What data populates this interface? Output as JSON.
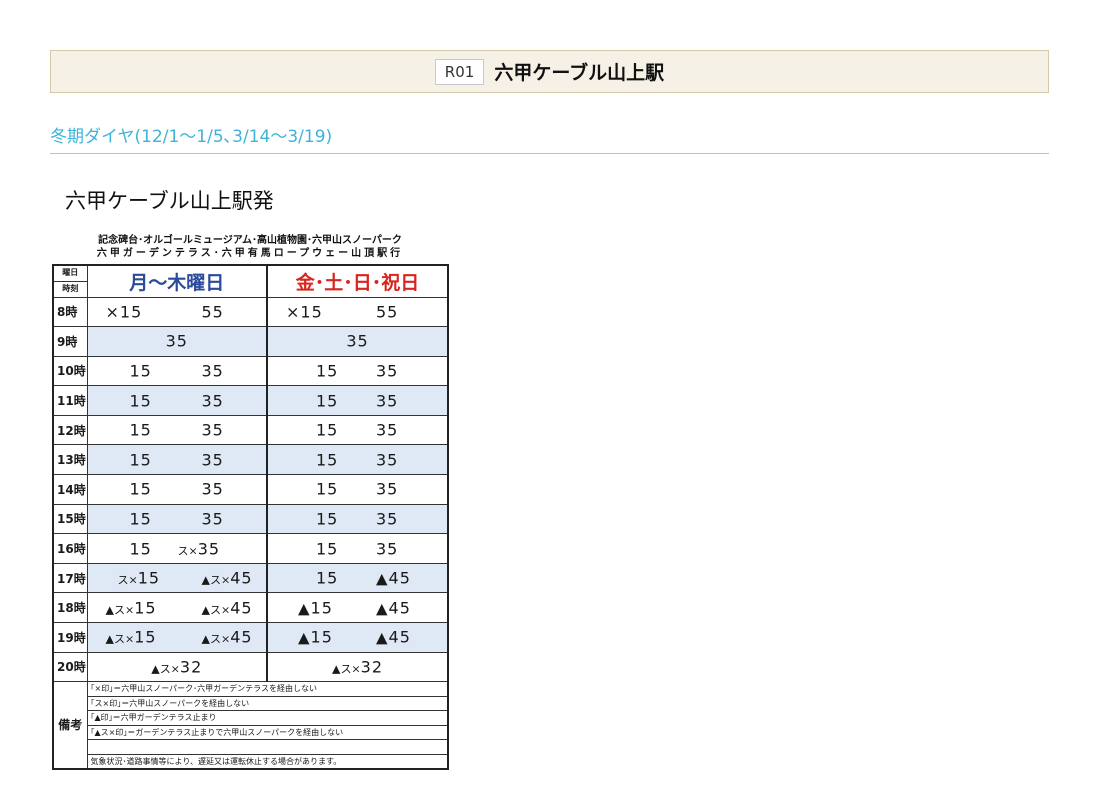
{
  "station": {
    "code": "R01",
    "name": "六甲ケーブル山上駅"
  },
  "period": "冬期ダイヤ(12/1～1/5､3/14～3/19)",
  "departure_title": "六甲ケーブル山上駅発",
  "destinations": {
    "line1": "記念碑台･オルゴールミュージアム･高山植物園･六甲山スノーパーク",
    "line2": "六甲ガーデンテラス･六甲有馬ロープウェー山頂駅行"
  },
  "header": {
    "youbi": "曜日",
    "jikoku": "時刻",
    "weekday": "月～木曜日",
    "weekend": "金･土･日･祝日"
  },
  "rows": [
    {
      "hour": "8時",
      "blue": false,
      "wk": [
        "×15",
        "55"
      ],
      "we": [
        "×15",
        "55"
      ]
    },
    {
      "hour": "9時",
      "blue": true,
      "wk_full": "35",
      "we_full": "35"
    },
    {
      "hour": "10時",
      "blue": false,
      "wk": [
        "15",
        "35"
      ],
      "we": [
        "15",
        "35"
      ]
    },
    {
      "hour": "11時",
      "blue": true,
      "wk": [
        "15",
        "35"
      ],
      "we": [
        "15",
        "35"
      ]
    },
    {
      "hour": "12時",
      "blue": false,
      "wk": [
        "15",
        "35"
      ],
      "we": [
        "15",
        "35"
      ]
    },
    {
      "hour": "13時",
      "blue": true,
      "wk": [
        "15",
        "35"
      ],
      "we": [
        "15",
        "35"
      ]
    },
    {
      "hour": "14時",
      "blue": false,
      "wk": [
        "15",
        "35"
      ],
      "we": [
        "15",
        "35"
      ]
    },
    {
      "hour": "15時",
      "blue": true,
      "wk": [
        "15",
        "35"
      ],
      "we": [
        "15",
        "35"
      ]
    },
    {
      "hour": "16時",
      "blue": false,
      "wk": [
        "15",
        "ス×35"
      ],
      "we": [
        "15",
        "35"
      ]
    },
    {
      "hour": "17時",
      "blue": true,
      "wk": [
        "ス×15",
        "▲ス×45"
      ],
      "we": [
        "15",
        "▲45"
      ]
    },
    {
      "hour": "18時",
      "blue": false,
      "wk": [
        "▲ス×15",
        "▲ス×45"
      ],
      "we": [
        "▲15",
        "▲45"
      ]
    },
    {
      "hour": "19時",
      "blue": true,
      "wk": [
        "▲ス×15",
        "▲ス×45"
      ],
      "we": [
        "▲15",
        "▲45"
      ]
    },
    {
      "hour": "20時",
      "blue": false,
      "wk_full": "▲ス×32",
      "we_full": "▲ス×32"
    }
  ],
  "notes": {
    "label": "備考",
    "items": [
      "｢×印｣＝六甲山スノーパーク･六甲ガーデンテラスを経由しない",
      "｢ス×印｣＝六甲山スノーパークを経由しない",
      "｢▲印｣＝六甲ガーデンテラス止まり",
      "｢▲ス×印｣＝ガーデンテラス止まりで六甲山スノーパークを経由しない",
      "",
      "気象状況･道路事情等により、遅延又は運転休止する場合があります。"
    ]
  }
}
